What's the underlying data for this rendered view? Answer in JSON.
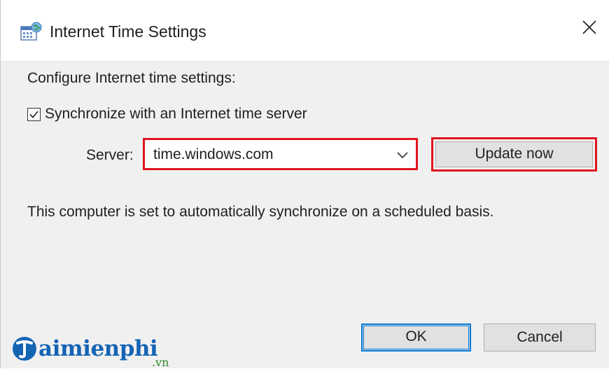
{
  "window": {
    "title": "Internet Time Settings",
    "icon": "calendar-globe-icon",
    "close_icon": "close-icon"
  },
  "content": {
    "heading": "Configure Internet time settings:",
    "sync_checkbox": {
      "label": "Synchronize with an Internet time server",
      "checked": true
    },
    "server": {
      "label": "Server:",
      "value": "time.windows.com"
    },
    "update_button": "Update now",
    "status": "This computer is set to automatically synchronize on a scheduled basis."
  },
  "footer": {
    "ok_label": "OK",
    "cancel_label": "Cancel"
  },
  "watermark": {
    "text": "aimienphi",
    "suffix": ".vn"
  },
  "colors": {
    "highlight": "#e0141e",
    "focus": "#0078d7",
    "watermark": "#1464b4"
  }
}
